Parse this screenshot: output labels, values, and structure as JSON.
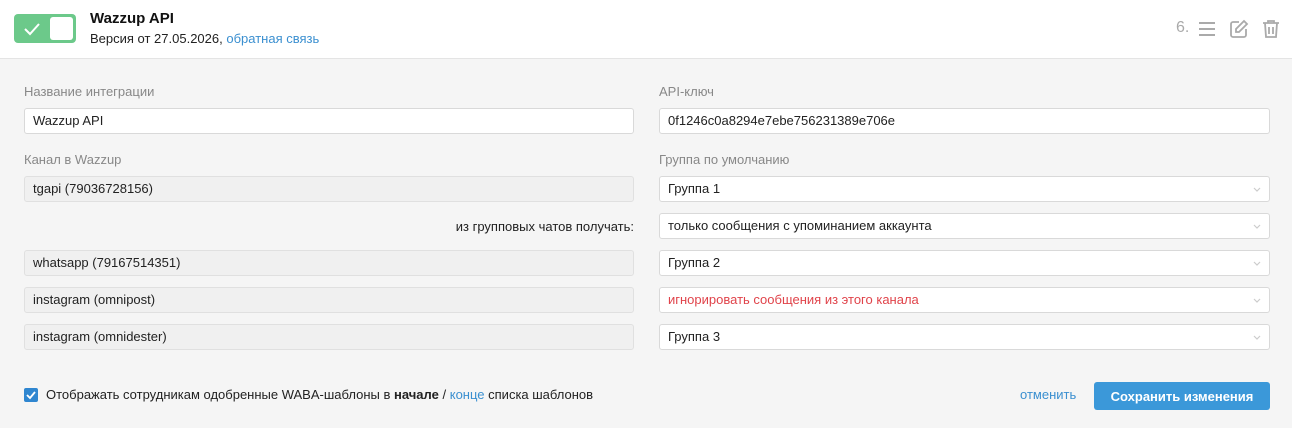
{
  "header": {
    "title": "Wazzup API",
    "version_text": "Версия от 27.05.2026,",
    "feedback_link": "обратная связь",
    "order_number": "6.",
    "toggle_on": true
  },
  "form": {
    "integration_name_label": "Название интеграции",
    "integration_name_value": "Wazzup API",
    "api_key_label": "API-ключ",
    "api_key_value": "0f1246c0a8294e7ebe756231389e706e",
    "channel_label": "Канал в Wazzup",
    "default_group_label": "Группа по умолчанию",
    "group_chats_label": "из групповых чатов получать:",
    "rows": [
      {
        "channel": "tgapi (79036728156)",
        "group": "Группа 1"
      },
      {
        "channel": "",
        "group": "только сообщения с упоминанием аккаунта"
      },
      {
        "channel": "whatsapp (79167514351)",
        "group": "Группа 2"
      },
      {
        "channel": "instagram (omnipost)",
        "group": "игнорировать сообщения из этого канала"
      },
      {
        "channel": "instagram (omnidester)",
        "group": "Группа 3"
      }
    ]
  },
  "footer": {
    "checkbox_checked": true,
    "text_before": "Отображать сотрудникам одобренные WABA-шаблоны в",
    "bold_word": "начале",
    "separator": "/",
    "link_word": "конце",
    "text_after": "списка шаблонов",
    "cancel_label": "отменить",
    "save_label": "Сохранить изменения"
  },
  "colors": {
    "toggle_green": "#6cc98a",
    "link_blue": "#3a8fd0",
    "save_blue": "#3b98d9",
    "warning_red": "#e0434a"
  },
  "icons": [
    "check-icon",
    "menu-icon",
    "edit-icon",
    "trash-icon",
    "chevron-down-icon"
  ]
}
